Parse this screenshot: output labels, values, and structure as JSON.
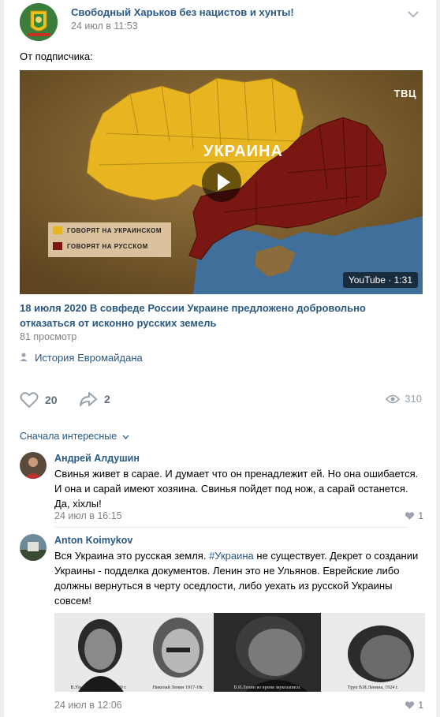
{
  "post": {
    "group_name": "Свободный Харьков без нацистов и хунты!",
    "date": "24 июл в 11:53",
    "text": "От подписчика:",
    "video": {
      "channel_logo": "ТВЦ",
      "map_title": "УКРАИНА",
      "legend": [
        {
          "label": "ГОВОРЯТ НА УКРАИНСКОМ",
          "color": "#e8b521"
        },
        {
          "label": "ГОВОРЯТ НА РУССКОМ",
          "color": "#7a1712"
        }
      ],
      "badge": "YouTube · 1:31",
      "title": "18 июля 2020 В совфеде России Украине предложено добровольно отказаться от исконно русских земель",
      "views": "81 просмотр"
    },
    "source": "История Евромайдана",
    "likes": "20",
    "shares": "2",
    "view_count": "310"
  },
  "comments": {
    "sort_label": "Сначала интересные",
    "items": [
      {
        "author": "Андрей Алдушин",
        "text": "Свинья живет в сарае. И думает что он пренадлежит ей. Но она ошибается. И она и сарай имеют хозяина. Свинья пойдет под нож, а сарай останется. Да, хіхлы!",
        "date": "24 июл в 16:15",
        "likes": "1"
      },
      {
        "author": "Anton Koimykov",
        "text_before": "Вся Украина это русская земля. ",
        "hashtag": "#Украина",
        "text_after": " не существует. Декрет о создании Украины - подделка документов. Ленин это не Ульянов. Еврейские либо должны вернуться в черту оседлости, либо уехать из русской Украины совсем!",
        "photo_captions": [
          "В.Ульянов в Самаре, 1890 г.",
          "Николай Ленин 1917-18г.",
          "В.И.Ленин во время звукозаписи.",
          "Труп В.И.Ленина, 1924 г."
        ],
        "date": "24 июл в 12:06",
        "likes": "1"
      }
    ]
  },
  "colors": {
    "link": "#2a5885",
    "muted": "#828282",
    "ukrainian": "#e8b521",
    "russian": "#7a1712",
    "sea": "#3f6f9a"
  }
}
